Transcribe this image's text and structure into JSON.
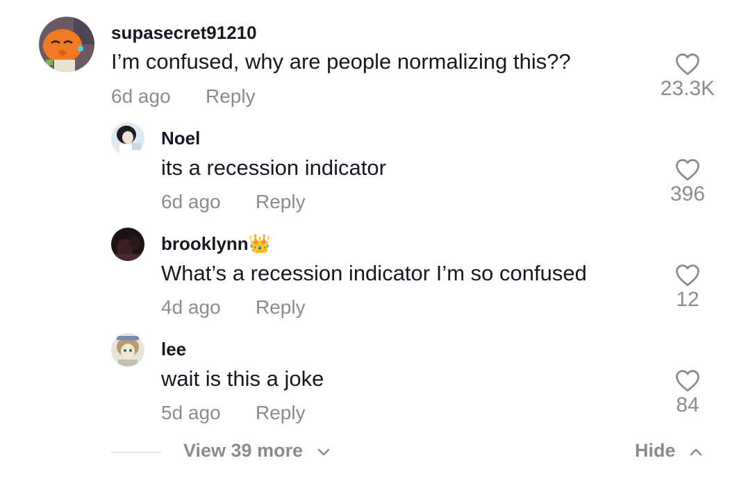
{
  "comments": [
    {
      "username": "supasecret91210",
      "text": "I’m confused, why are people normalizing this??",
      "time": "6d ago",
      "reply_label": "Reply",
      "likes": "23.3K",
      "avatar": "cartoon-orange-cat-avatar"
    },
    {
      "username": "Noel",
      "text": "its a recession indicator",
      "time": "6d ago",
      "reply_label": "Reply",
      "likes": "396",
      "avatar": "anime-girl-avatar"
    },
    {
      "username": "brooklynn👑",
      "text": "What’s a recession indicator I’m so confused",
      "time": "4d ago",
      "reply_label": "Reply",
      "likes": "12",
      "avatar": "dark-photo-avatar"
    },
    {
      "username": "lee",
      "text": "wait is this a joke",
      "time": "5d ago",
      "reply_label": "Reply",
      "likes": "84",
      "avatar": "anime-character-avatar"
    }
  ],
  "footer": {
    "view_more_label": "View 39 more",
    "hide_label": "Hide"
  },
  "icons": {
    "like": "heart-outline-icon",
    "expand": "chevron-down-icon",
    "collapse": "chevron-up-icon"
  },
  "colors": {
    "text_primary": "#161823",
    "text_secondary": "#8a8b91"
  }
}
